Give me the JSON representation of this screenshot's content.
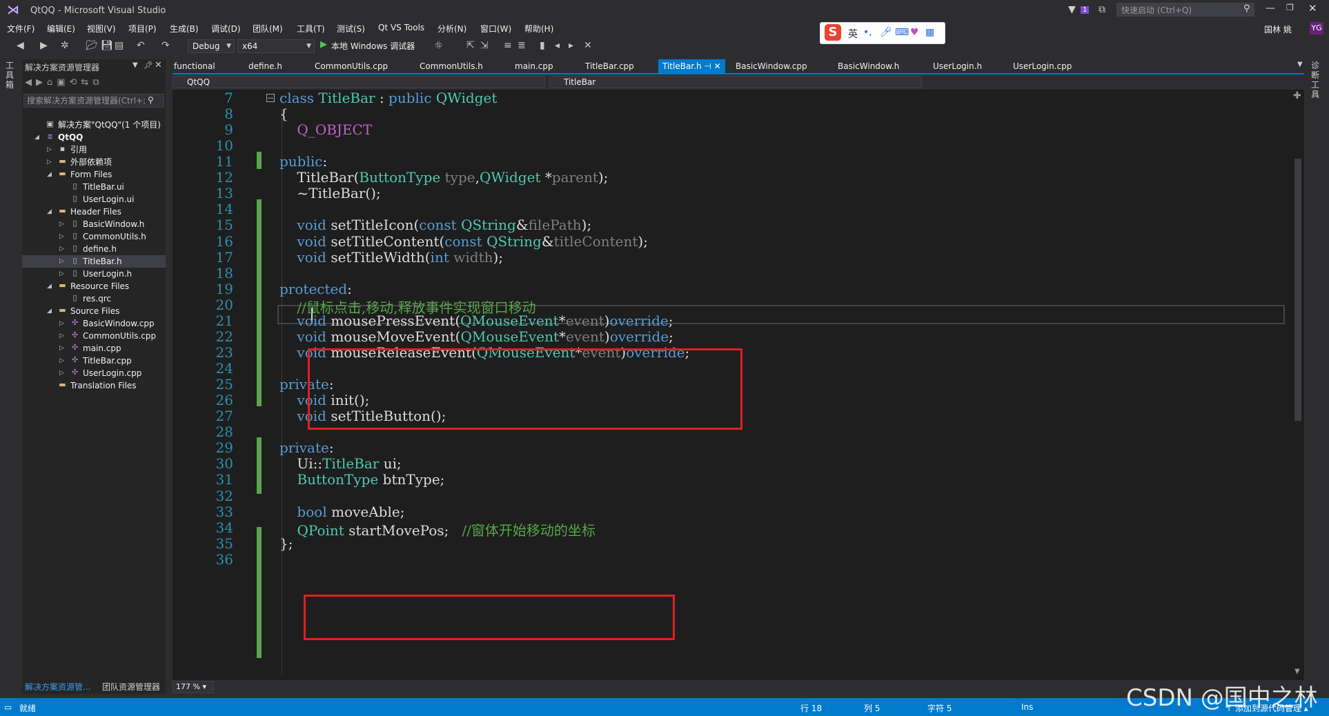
{
  "window": {
    "title": "QtQQ - Microsoft Visual Studio",
    "quick_launch_placeholder": "快速启动 (Ctrl+Q)",
    "notification_count": "1",
    "user_name": "国林 姚",
    "user_avatar": "YG"
  },
  "menu": [
    "文件(F)",
    "编辑(E)",
    "视图(V)",
    "项目(P)",
    "生成(B)",
    "调试(D)",
    "团队(M)",
    "工具(T)",
    "测试(S)",
    "Qt VS Tools",
    "分析(N)",
    "窗口(W)",
    "帮助(H)"
  ],
  "ime": {
    "mode": "英",
    "logo": "S"
  },
  "toolbar": {
    "config": "Debug",
    "platform": "x64",
    "run_label": "本地 Windows 调试器"
  },
  "side_strips": {
    "left": "工具箱",
    "right": "诊断工具"
  },
  "solution_explorer": {
    "title": "解决方案资源管理器",
    "search_placeholder": "搜索解决方案资源管理器(Ctrl+;",
    "tree": [
      {
        "label": "解决方案\"QtQQ\"(1 个项目)",
        "depth": 0,
        "twisty": "",
        "icon": "solution-icon",
        "bold": false
      },
      {
        "label": "QtQQ",
        "depth": 0,
        "twisty": "◢",
        "icon": "project-icon",
        "bold": true
      },
      {
        "label": "引用",
        "depth": 1,
        "twisty": "▷",
        "icon": "references-icon",
        "bold": false
      },
      {
        "label": "外部依赖项",
        "depth": 1,
        "twisty": "▷",
        "icon": "folder-icon",
        "bold": false
      },
      {
        "label": "Form Files",
        "depth": 1,
        "twisty": "◢",
        "icon": "folder-icon",
        "bold": false
      },
      {
        "label": "TitleBar.ui",
        "depth": 2,
        "twisty": "",
        "icon": "file-icon",
        "bold": false
      },
      {
        "label": "UserLogin.ui",
        "depth": 2,
        "twisty": "",
        "icon": "file-icon",
        "bold": false
      },
      {
        "label": "Header Files",
        "depth": 1,
        "twisty": "◢",
        "icon": "folder-icon",
        "bold": false
      },
      {
        "label": "BasicWindow.h",
        "depth": 2,
        "twisty": "▷",
        "icon": "file-icon",
        "bold": false
      },
      {
        "label": "CommonUtils.h",
        "depth": 2,
        "twisty": "▷",
        "icon": "file-icon",
        "bold": false
      },
      {
        "label": "define.h",
        "depth": 2,
        "twisty": "▷",
        "icon": "file-icon",
        "bold": false
      },
      {
        "label": "TitleBar.h",
        "depth": 2,
        "twisty": "▷",
        "icon": "file-icon",
        "bold": false,
        "selected": true
      },
      {
        "label": "UserLogin.h",
        "depth": 2,
        "twisty": "▷",
        "icon": "file-icon",
        "bold": false
      },
      {
        "label": "Resource Files",
        "depth": 1,
        "twisty": "◢",
        "icon": "folder-icon",
        "bold": false
      },
      {
        "label": "res.qrc",
        "depth": 2,
        "twisty": "",
        "icon": "file-icon",
        "bold": false
      },
      {
        "label": "Source Files",
        "depth": 1,
        "twisty": "◢",
        "icon": "folder-icon",
        "bold": false
      },
      {
        "label": "BasicWindow.cpp",
        "depth": 2,
        "twisty": "▷",
        "icon": "cpp-file-icon",
        "bold": false
      },
      {
        "label": "CommonUtils.cpp",
        "depth": 2,
        "twisty": "▷",
        "icon": "cpp-file-icon",
        "bold": false
      },
      {
        "label": "main.cpp",
        "depth": 2,
        "twisty": "▷",
        "icon": "cpp-file-icon",
        "bold": false
      },
      {
        "label": "TitleBar.cpp",
        "depth": 2,
        "twisty": "▷",
        "icon": "cpp-file-icon",
        "bold": false
      },
      {
        "label": "UserLogin.cpp",
        "depth": 2,
        "twisty": "▷",
        "icon": "cpp-file-icon",
        "bold": false
      },
      {
        "label": "Translation Files",
        "depth": 1,
        "twisty": "",
        "icon": "folder-icon",
        "bold": false
      }
    ],
    "bottom_tabs": [
      "解决方案资源管...",
      "团队资源管理器"
    ]
  },
  "doc_tabs": [
    "functional",
    "define.h",
    "CommonUtils.cpp",
    "CommonUtils.h",
    "main.cpp",
    "TitleBar.cpp",
    "TitleBar.h",
    "BasicWindow.cpp",
    "BasicWindow.h",
    "UserLogin.h",
    "UserLogin.cpp"
  ],
  "active_tab": "TitleBar.h",
  "nav": {
    "project": "QtQQ",
    "class": "TitleBar"
  },
  "editor": {
    "zoom": "177 %",
    "lines": [
      {
        "n": "7",
        "tokens": [
          {
            "t": "class ",
            "c": "kw"
          },
          {
            "t": "TitleBar",
            "c": "ty"
          },
          {
            "t": " : ",
            "c": ""
          },
          {
            "t": "public ",
            "c": "kw"
          },
          {
            "t": "QWidget",
            "c": "ty"
          }
        ]
      },
      {
        "n": "8",
        "tokens": [
          {
            "t": "{",
            "c": ""
          }
        ]
      },
      {
        "n": "9",
        "tokens": [
          {
            "t": "    Q_OBJECT",
            "c": "mac"
          }
        ]
      },
      {
        "n": "10",
        "tokens": []
      },
      {
        "n": "11",
        "tokens": [
          {
            "t": "public",
            "c": "kw"
          },
          {
            "t": ":",
            "c": ""
          }
        ]
      },
      {
        "n": "12",
        "tokens": [
          {
            "t": "    TitleBar(",
            "c": ""
          },
          {
            "t": "ButtonType",
            "c": "ty"
          },
          {
            "t": " type",
            "c": "pa"
          },
          {
            "t": ",",
            "c": ""
          },
          {
            "t": "QWidget",
            "c": "ty"
          },
          {
            "t": " *",
            "c": ""
          },
          {
            "t": "parent",
            "c": "pa"
          },
          {
            "t": ");",
            "c": ""
          }
        ]
      },
      {
        "n": "13",
        "tokens": [
          {
            "t": "    ~TitleBar();",
            "c": ""
          }
        ]
      },
      {
        "n": "14",
        "tokens": []
      },
      {
        "n": "15",
        "tokens": [
          {
            "t": "    void ",
            "c": "kw"
          },
          {
            "t": "setTitleIcon(",
            "c": ""
          },
          {
            "t": "const ",
            "c": "kw"
          },
          {
            "t": "QString",
            "c": "ty"
          },
          {
            "t": "&",
            "c": ""
          },
          {
            "t": "filePath",
            "c": "pa"
          },
          {
            "t": ");",
            "c": ""
          }
        ]
      },
      {
        "n": "16",
        "tokens": [
          {
            "t": "    void ",
            "c": "kw"
          },
          {
            "t": "setTitleContent(",
            "c": ""
          },
          {
            "t": "const ",
            "c": "kw"
          },
          {
            "t": "QString",
            "c": "ty"
          },
          {
            "t": "&",
            "c": ""
          },
          {
            "t": "titleContent",
            "c": "pa"
          },
          {
            "t": ");",
            "c": ""
          }
        ]
      },
      {
        "n": "17",
        "tokens": [
          {
            "t": "    void ",
            "c": "kw"
          },
          {
            "t": "setTitleWidth(",
            "c": ""
          },
          {
            "t": "int ",
            "c": "kw"
          },
          {
            "t": "width",
            "c": "pa"
          },
          {
            "t": ");",
            "c": ""
          }
        ]
      },
      {
        "n": "18",
        "tokens": []
      },
      {
        "n": "19",
        "tokens": [
          {
            "t": "protected",
            "c": "kw"
          },
          {
            "t": ":",
            "c": ""
          }
        ]
      },
      {
        "n": "20",
        "tokens": [
          {
            "t": "    //鼠标点击,移动,释放事件实现窗口移动",
            "c": "cm"
          }
        ]
      },
      {
        "n": "21",
        "tokens": [
          {
            "t": "    void ",
            "c": "kw"
          },
          {
            "t": "mousePressEvent(",
            "c": ""
          },
          {
            "t": "QMouseEvent",
            "c": "ty"
          },
          {
            "t": "*",
            "c": ""
          },
          {
            "t": "event",
            "c": "pa"
          },
          {
            "t": ")",
            "c": ""
          },
          {
            "t": "override",
            "c": "kw"
          },
          {
            "t": ";",
            "c": ""
          }
        ]
      },
      {
        "n": "22",
        "tokens": [
          {
            "t": "    void ",
            "c": "kw"
          },
          {
            "t": "mouseMoveEvent(",
            "c": ""
          },
          {
            "t": "QMouseEvent",
            "c": "ty"
          },
          {
            "t": "*",
            "c": ""
          },
          {
            "t": "event",
            "c": "pa"
          },
          {
            "t": ")",
            "c": ""
          },
          {
            "t": "override",
            "c": "kw"
          },
          {
            "t": ";",
            "c": ""
          }
        ]
      },
      {
        "n": "23",
        "tokens": [
          {
            "t": "    void ",
            "c": "kw"
          },
          {
            "t": "mouseReleaseEvent(",
            "c": ""
          },
          {
            "t": "QMouseEvent",
            "c": "ty"
          },
          {
            "t": "*",
            "c": ""
          },
          {
            "t": "event",
            "c": "pa"
          },
          {
            "t": ")",
            "c": ""
          },
          {
            "t": "override",
            "c": "kw"
          },
          {
            "t": ";",
            "c": ""
          }
        ]
      },
      {
        "n": "24",
        "tokens": []
      },
      {
        "n": "25",
        "tokens": [
          {
            "t": "private",
            "c": "kw"
          },
          {
            "t": ":",
            "c": ""
          }
        ]
      },
      {
        "n": "26",
        "tokens": [
          {
            "t": "    void ",
            "c": "kw"
          },
          {
            "t": "init();",
            "c": ""
          }
        ]
      },
      {
        "n": "27",
        "tokens": [
          {
            "t": "    void ",
            "c": "kw"
          },
          {
            "t": "setTitleButton();",
            "c": ""
          }
        ]
      },
      {
        "n": "28",
        "tokens": []
      },
      {
        "n": "29",
        "tokens": [
          {
            "t": "private",
            "c": "kw"
          },
          {
            "t": ":",
            "c": ""
          }
        ]
      },
      {
        "n": "30",
        "tokens": [
          {
            "t": "    Ui::",
            "c": ""
          },
          {
            "t": "TitleBar",
            "c": "ty"
          },
          {
            "t": " ui;",
            "c": ""
          }
        ]
      },
      {
        "n": "31",
        "tokens": [
          {
            "t": "    ",
            "c": ""
          },
          {
            "t": "ButtonType",
            "c": "ty"
          },
          {
            "t": " btnType;",
            "c": ""
          }
        ]
      },
      {
        "n": "32",
        "tokens": []
      },
      {
        "n": "33",
        "tokens": [
          {
            "t": "    bool ",
            "c": "kw"
          },
          {
            "t": "moveAble;",
            "c": ""
          }
        ]
      },
      {
        "n": "34",
        "tokens": [
          {
            "t": "    ",
            "c": ""
          },
          {
            "t": "QPoint",
            "c": "ty"
          },
          {
            "t": " startMovePos;   ",
            "c": ""
          },
          {
            "t": "//窗体开始移动的坐标",
            "c": "cm"
          }
        ]
      },
      {
        "n": "35",
        "tokens": [
          {
            "t": "};",
            "c": ""
          }
        ]
      },
      {
        "n": "36",
        "tokens": []
      }
    ]
  },
  "status": {
    "ready": "就绪",
    "line": "行 18",
    "col": "列 5",
    "char": "字符 5",
    "mode": "Ins",
    "source_control": "↑ 添加到源代码管理 ▴"
  },
  "watermark": "CSDN @国中之林",
  "colors": {
    "accent": "#007acc",
    "keyword": "#569cd6",
    "type": "#4ec9b0",
    "comment": "#57a64a",
    "highlight_box": "#e02020"
  }
}
